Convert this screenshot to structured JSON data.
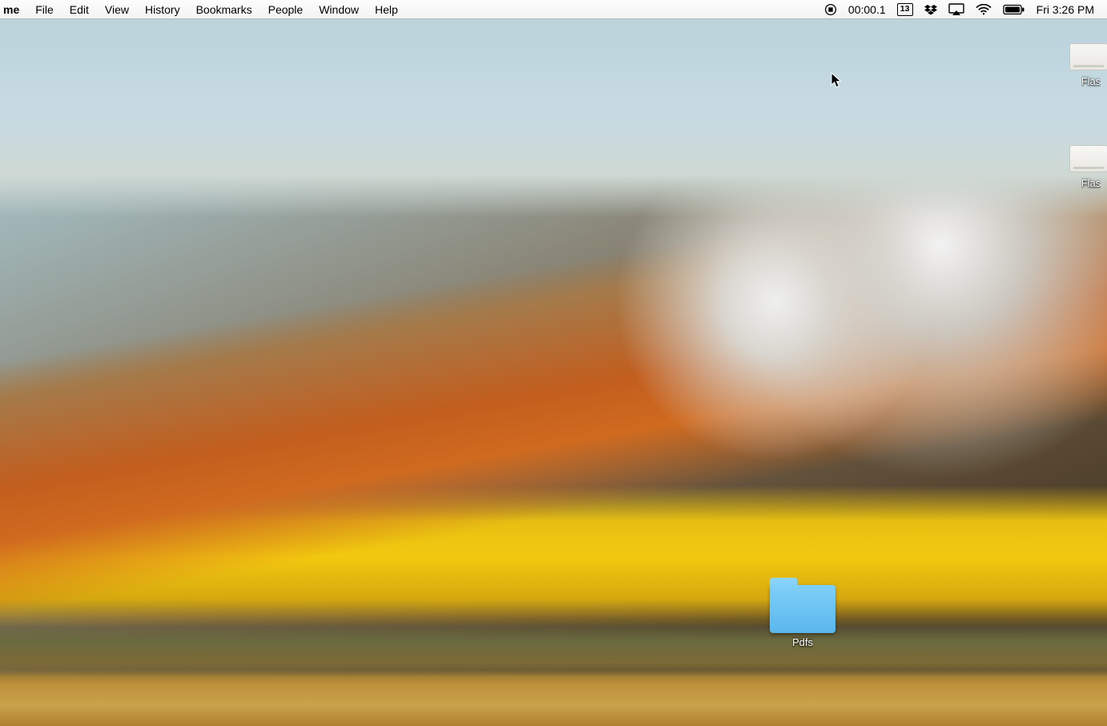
{
  "menubar": {
    "app_name": "me",
    "items": [
      "File",
      "Edit",
      "View",
      "History",
      "Bookmarks",
      "People",
      "Window",
      "Help"
    ],
    "status": {
      "recording_time": "00:00.1",
      "calendar_day": "13",
      "clock": "Fri 3:26 PM"
    }
  },
  "desktop": {
    "drives": [
      {
        "label": "Flas"
      },
      {
        "label": "Flas"
      }
    ],
    "folder": {
      "label": "Pdfs"
    }
  }
}
